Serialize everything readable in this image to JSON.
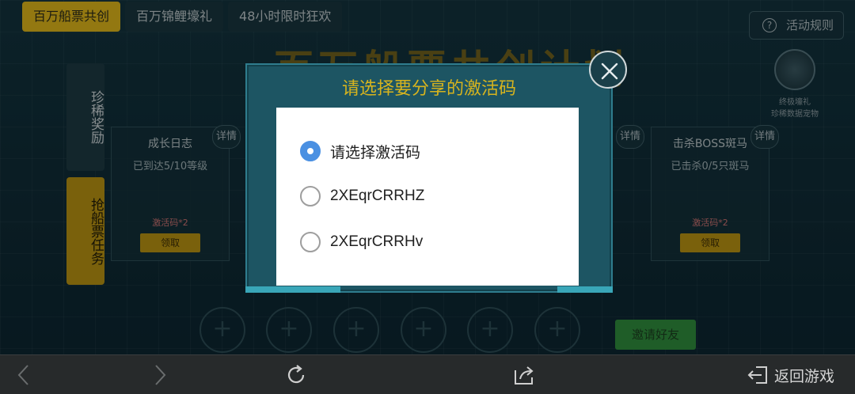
{
  "header_tabs": [
    "百万船票共创",
    "百万锦鲤壕礼",
    "48小时限时狂欢"
  ],
  "rules_button": "活动规则",
  "rules_icon": "question-icon",
  "page_title": "百万船票共创计划",
  "side_tabs": [
    "珍稀奖励",
    "抢船票任务"
  ],
  "gift": {
    "line1": "终极壕礼",
    "line2": "珍稀数据宠物"
  },
  "task_cards": [
    {
      "title": "成长日志",
      "subtitle": "已到达5/10等级",
      "reward": "激活码*2",
      "claim": "领取"
    },
    {
      "title": "击杀BOSS斑马",
      "subtitle": "已击杀0/5只斑马",
      "reward": "激活码*2",
      "claim": "领取"
    }
  ],
  "detail_label": "详情",
  "invite_button": "邀请好友",
  "modal": {
    "title": "请选择要分享的激活码",
    "close_icon": "close-icon",
    "options": [
      {
        "label": "请选择激活码",
        "selected": true
      },
      {
        "label": "2XEqrCRRHZ",
        "selected": false
      },
      {
        "label": "2XEqrCRRHv",
        "selected": false
      }
    ]
  },
  "navbar": {
    "back_icon": "chevron-left-icon",
    "forward_icon": "chevron-right-icon",
    "refresh_icon": "refresh-icon",
    "share_icon": "share-icon",
    "exit_icon": "exit-icon",
    "return_label": "返回游戏"
  },
  "colors": {
    "accent_gold": "#d7b41e",
    "radio_blue": "#4a90e2",
    "navbar_bg": "#272a2b"
  }
}
